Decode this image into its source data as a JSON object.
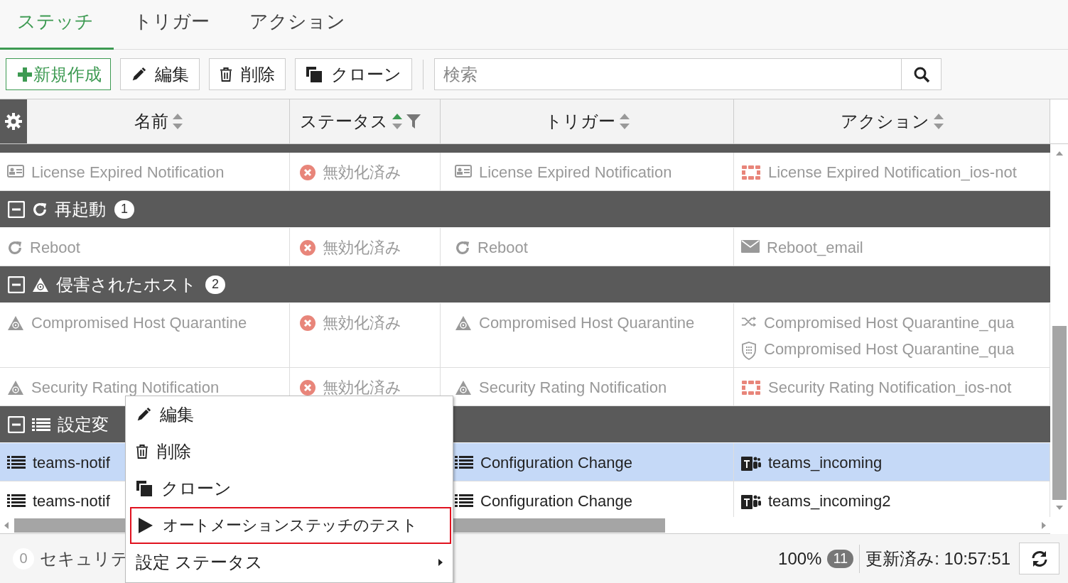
{
  "tabs": [
    {
      "label": "ステッチ",
      "selected": true
    },
    {
      "label": "トリガー",
      "selected": false
    },
    {
      "label": "アクション",
      "selected": false
    }
  ],
  "toolbar": {
    "buttons": [
      {
        "kind": "create",
        "label": "新規作成"
      },
      {
        "kind": "edit",
        "label": "編集"
      },
      {
        "kind": "delete",
        "label": "削除"
      },
      {
        "kind": "clone",
        "label": "クローン"
      }
    ],
    "search": {
      "placeholder": "検索"
    }
  },
  "table": {
    "columns": [
      {
        "label": "名前",
        "sorted": false,
        "filter": false
      },
      {
        "label": "ステータス",
        "sorted": true,
        "filter": true
      },
      {
        "label": "トリガー",
        "sorted": false,
        "filter": false
      },
      {
        "label": "アクション",
        "sorted": false,
        "filter": false
      }
    ],
    "rows": [
      {
        "kind": "entry",
        "name": {
          "kind": "license",
          "label": "License Expired Notification"
        },
        "status": "無効化済み",
        "trigger": {
          "kind": "license",
          "label": "License Expired Notification"
        },
        "disabled": true,
        "selected": false,
        "actions": [
          {
            "kind": "fabric",
            "label": "License Expired Notification_ios-not"
          }
        ]
      },
      {
        "kind": "group",
        "icon": {
          "kind": "reboot"
        },
        "label": "再起動",
        "count": "1",
        "expanded": true
      },
      {
        "kind": "entry",
        "name": {
          "kind": "reboot",
          "label": "Reboot"
        },
        "status": "無効化済み",
        "trigger": {
          "kind": "reboot",
          "label": "Reboot"
        },
        "disabled": true,
        "selected": false,
        "actions": [
          {
            "kind": "email",
            "label": "Reboot_email"
          }
        ]
      },
      {
        "kind": "group",
        "icon": {
          "kind": "compromised"
        },
        "label": "侵害されたホスト",
        "count": "2",
        "expanded": true
      },
      {
        "kind": "entry",
        "name": {
          "kind": "compromised",
          "label": "Compromised Host Quarantine"
        },
        "status": "無効化済み",
        "trigger": {
          "kind": "compromised",
          "label": "Compromised Host Quarantine"
        },
        "disabled": true,
        "selected": false,
        "actions": [
          {
            "kind": "shuffle",
            "label": "Compromised Host Quarantine_qua"
          },
          {
            "kind": "shield",
            "label": "Compromised Host Quarantine_qua"
          }
        ]
      },
      {
        "kind": "entry",
        "name": {
          "kind": "compromised",
          "label": "Security Rating Notification"
        },
        "status": "無効化済み",
        "trigger": {
          "kind": "compromised",
          "label": "Security Rating Notification"
        },
        "disabled": true,
        "selected": false,
        "actions": [
          {
            "kind": "fabric",
            "label": "Security Rating Notification_ios-not"
          }
        ]
      },
      {
        "kind": "group",
        "icon": {
          "kind": "config"
        },
        "label": "設定変",
        "expanded": true
      },
      {
        "kind": "entry",
        "name": {
          "kind": "config",
          "label": "teams-notif"
        },
        "trigger": {
          "kind": "config",
          "label": "Configuration Change"
        },
        "disabled": false,
        "selected": true,
        "actions": [
          {
            "kind": "teams",
            "label": "teams_incoming"
          }
        ]
      },
      {
        "kind": "entry",
        "name": {
          "kind": "config",
          "label": "teams-notif"
        },
        "trigger": {
          "kind": "config",
          "label": "Configuration Change"
        },
        "disabled": false,
        "selected": false,
        "actions": [
          {
            "kind": "teams",
            "label": "teams_incoming2"
          }
        ]
      }
    ]
  },
  "context_menu": {
    "items": [
      {
        "kind": "edit",
        "label": "編集",
        "selected": false
      },
      {
        "kind": "delete",
        "label": "削除",
        "selected": false
      },
      {
        "kind": "clone",
        "label": "クローン",
        "selected": false
      },
      {
        "kind": "test",
        "label": "オートメーションステッチのテスト",
        "selected": true
      },
      {
        "kind": "submenu",
        "label": "設定 ステータス",
        "selected": false
      }
    ]
  },
  "status_bar": {
    "count": "0",
    "label": "セキュリテ",
    "zoom": "100%",
    "zoom_badge": "11",
    "updated": "更新済み: 10:57:51"
  }
}
